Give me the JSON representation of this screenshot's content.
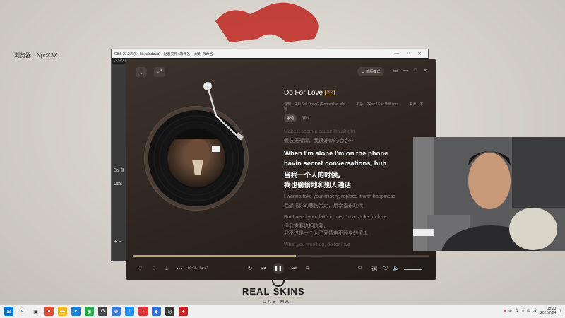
{
  "desktop": {
    "label": "浏览器：NpcX3X",
    "brand": "REAL SKINS",
    "brand_sub": "DASIMA"
  },
  "obs": {
    "title": "OBS 27.2.4 (64-bit, windows) - 配置文件: 未命名 - 场景: 未命名",
    "menu": "文件(F)",
    "side_label_1": "Bo 直",
    "side_label_2": "ObS",
    "side_label_3": "+ −",
    "controls": [
      "—",
      "□",
      "✕"
    ]
  },
  "player": {
    "mode_label": "新版模式",
    "song": {
      "title": "Do For Love",
      "badge": "VIP",
      "singer": "歌手：2Pac / Eric Williams",
      "album": "专辑：R U Still Down? [Remember Me]",
      "source": "来源：本地"
    },
    "tabs": [
      {
        "label": "歌词",
        "active": true
      },
      {
        "label": "百科",
        "active": false
      }
    ],
    "lyrics": [
      {
        "text": "Make it seem a cause I'm alright",
        "style": "faded"
      },
      {
        "text": "假装无所谓，我很好似的哈哈～",
        "style": "dim"
      },
      {
        "text": "When I'm alone I'm on the phone",
        "style": "current"
      },
      {
        "text": "havin secret conversations, huh",
        "style": "current"
      },
      {
        "text": "当我一个人的时候，",
        "style": "current"
      },
      {
        "text": "我也偷偷地和别人通话",
        "style": "current"
      },
      {
        "text": "I wanna take your misery, replace it with happiness",
        "style": "dim"
      },
      {
        "text": "我想把你的悲伤带走，用幸福来取代",
        "style": "dim"
      },
      {
        "text": "But I need your faith in me, I'm a sucka for love",
        "style": "dim"
      },
      {
        "text": "但我需要你相信我，",
        "style": "dim"
      },
      {
        "text": "我不过是一个为了爱情奋不顾身的傻瓜",
        "style": "dim"
      },
      {
        "text": "What you won't do, do for love",
        "style": "faded"
      }
    ],
    "time": "02:36 / 04:43",
    "progress": 0.55,
    "volume": 0.8
  },
  "taskbar": {
    "clock_time": "18:23",
    "clock_date": "2022/7/24"
  },
  "colors": {
    "accent": "#c9a063",
    "player_bg": "#2c2420"
  }
}
